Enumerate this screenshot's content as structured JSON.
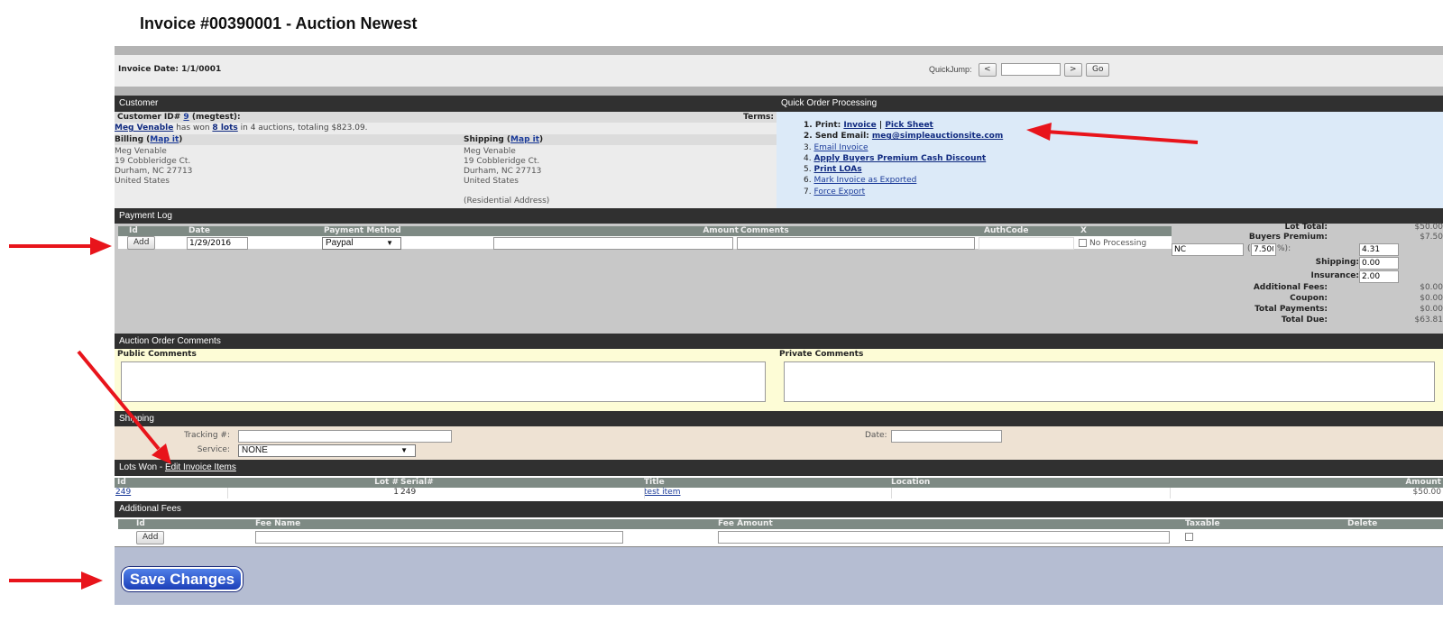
{
  "title": "Invoice #00390001 - Auction Newest",
  "invoice_date": "Invoice Date: 1/1/0001",
  "quickjump": {
    "label": "QuickJump:",
    "prev": "<",
    "next": ">",
    "go": "Go",
    "value": ""
  },
  "customer": {
    "header": "Customer",
    "id_prefix": "Customer ID#",
    "id": "9",
    "username": "(megtest):",
    "terms": "Terms:",
    "name": "Meg Venable",
    "won_text": "has won",
    "lots_link": "8 lots",
    "won_rest": "in 4 auctions, totaling $823.09.",
    "billing_label": "Billing (",
    "shipping_label": "Shipping (",
    "map_link": "Map it",
    "close_paren": ")",
    "billing_lines": [
      "Meg Venable",
      "19 Cobbleridge Ct.",
      "Durham, NC 27713",
      "United States"
    ],
    "shipping_lines": [
      "Meg Venable",
      "19 Cobbleridge Ct.",
      "Durham, NC 27713",
      "United States"
    ],
    "residential": "(Residential Address)"
  },
  "quick_order": {
    "header": "Quick Order Processing",
    "print_label": "1. Print:",
    "invoice_link": "Invoice",
    "separator": "|",
    "picksheet_link": "Pick Sheet",
    "send_email_label": "2. Send Email:",
    "email": "meg@simpleauctionsite.com",
    "n3": "3.",
    "email_invoice": "Email Invoice",
    "n4": "4.",
    "apply_discount": "Apply Buyers Premium Cash Discount",
    "n5": "5.",
    "print_loas": "Print LOAs",
    "n6": "6.",
    "mark_exported": "Mark Invoice as Exported",
    "n7": "7.",
    "force_export": "Force Export"
  },
  "payment_log": {
    "header": "Payment Log",
    "columns": [
      "Id",
      "Date",
      "Payment Method",
      "Amount",
      "Comments",
      "AuthCode",
      "X"
    ],
    "add_button": "Add",
    "date_value": "1/29/2016",
    "method_value": "Paypal",
    "no_processing": "No Processing"
  },
  "totals": {
    "lot_total_label": "Lot Total:",
    "lot_total": "$50.00",
    "bp_label": "Buyers Premium:",
    "bp": "$7.50",
    "tax_state": "NC",
    "tax_rate": "7.500",
    "tax_pct_suffix": "%):",
    "tax_paren": "(",
    "tax_value": "4.31",
    "shipping_label": "Shipping:",
    "shipping": "0.00",
    "insurance_label": "Insurance:",
    "insurance": "2.00",
    "fees_label": "Additional Fees:",
    "fees": "$0.00",
    "coupon_label": "Coupon:",
    "coupon": "$0.00",
    "payments_label": "Total Payments:",
    "payments": "$0.00",
    "due_label": "Total Due:",
    "due": "$63.81"
  },
  "comments": {
    "header": "Auction Order Comments",
    "public_label": "Public Comments",
    "private_label": "Private Comments"
  },
  "shipping_section": {
    "header": "Shipping",
    "tracking_label": "Tracking #:",
    "service_label": "Service:",
    "service_value": "NONE",
    "date_label": "Date:"
  },
  "lots_won": {
    "header": "Lots Won -",
    "edit_link": "Edit Invoice Items",
    "columns": [
      "Id",
      "Lot #",
      "Serial#",
      "Title",
      "Location",
      "Amount"
    ],
    "rows": [
      {
        "id": "249",
        "lot": "1",
        "serial": "249",
        "title": "test item",
        "location": "",
        "amount": "$50.00"
      }
    ]
  },
  "additional_fees": {
    "header": "Additional Fees",
    "columns": [
      "Id",
      "Fee Name",
      "Fee Amount",
      "Taxable",
      "Delete"
    ],
    "add_button": "Add"
  },
  "save_button": "Save Changes",
  "colors": {
    "dark_header": "#303030",
    "quick_bg": "#dceaf8",
    "comments_bg": "#fdfcd6",
    "shipping_bg": "#eee2d3",
    "save_bg": "#b5bdd2",
    "arrow": "#e8141b"
  }
}
